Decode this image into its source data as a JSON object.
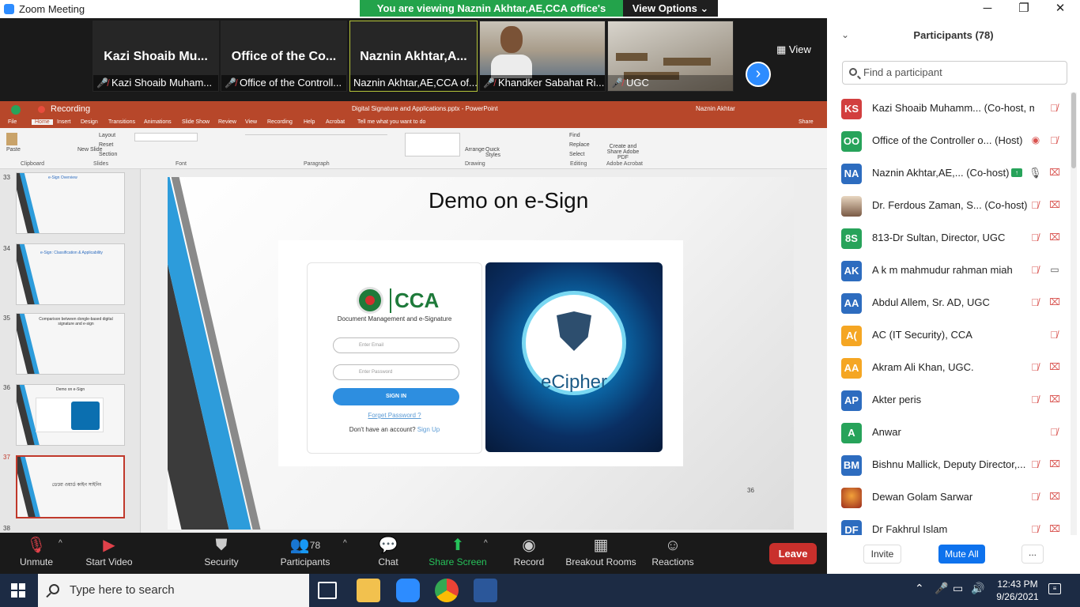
{
  "window": {
    "title": "Zoom Meeting",
    "minimize": "─",
    "restore": "❐",
    "close": "✕"
  },
  "banner": {
    "text": "You are viewing Naznin Akhtar,AE,CCA office's screen",
    "view_options": "View Options ⌄"
  },
  "strip": {
    "view_label": "View",
    "tiles": [
      {
        "big": "Kazi Shoaib Mu...",
        "name": "Kazi Shoaib Muham..."
      },
      {
        "big": "Office of the Co...",
        "name": "Office of the Controll..."
      },
      {
        "big": "Naznin Akhtar,A...",
        "name": "Naznin Akhtar,AE,CCA of..."
      },
      {
        "big": "",
        "name": "Khandker Sabahat Ri..."
      },
      {
        "big": "",
        "name": "UGC"
      }
    ],
    "next": "›"
  },
  "powerpoint": {
    "recording": "Recording",
    "doc_title": "Digital Signature and Applications.pptx - PowerPoint",
    "user": "Naznin Akhtar",
    "tabs": [
      "File",
      "Home",
      "Insert",
      "Design",
      "Transitions",
      "Animations",
      "Slide Show",
      "Review",
      "View",
      "Recording",
      "Help",
      "Acrobat",
      "Tell me what you want to do"
    ],
    "share": "Share",
    "ribbon_groups": [
      "Clipboard",
      "Slides",
      "Font",
      "Paragraph",
      "Drawing",
      "Editing",
      "Adobe Acrobat"
    ],
    "ribbon_items": [
      "Paste",
      "New Slide",
      "Layout",
      "Reset",
      "Section",
      "Find",
      "Replace",
      "Select",
      "Arrange",
      "Quick Styles",
      "Create and Share Adobe PDF"
    ],
    "thumb_numbers": [
      "33",
      "34",
      "35",
      "36",
      "37",
      "38"
    ],
    "thumb_titles": [
      "e-Sign Overview",
      "e-Sign: Classification & Applicability",
      "Comparison between dongle-based digital signature and e-sign",
      "Demo on e-Sign",
      "ডেমো ওয়ার্ড কাইন সাইনিং"
    ],
    "slide": {
      "title": "Demo on e-Sign",
      "cca": "CCA",
      "cca_sub": "Document Management and e-Signature",
      "email_ph": "Enter Email",
      "pass_ph": "Enter Password",
      "signin": "SIGN IN",
      "forgot": "Forget Password ?",
      "noacc": "Don't have an account?",
      "signup": "Sign Up",
      "ecipher": "eCipher",
      "page_number": "36"
    }
  },
  "participants": {
    "title": "Participants (78)",
    "search_placeholder": "Find a participant",
    "list": [
      {
        "initials": "KS",
        "color": "#d23f3f",
        "name": "Kazi Shoaib Muhamm... (Co-host, me)",
        "mic": "muted",
        "cam": "none"
      },
      {
        "initials": "OO",
        "color": "#27a35a",
        "name": "Office of the Controller o... (Host)",
        "mic": "muted",
        "cam": "rec"
      },
      {
        "initials": "NA",
        "color": "#2d6cbf",
        "name": "Naznin Akhtar,AE,... (Co-host)",
        "mic": "on",
        "cam": "off",
        "sharing": true
      },
      {
        "initials": "",
        "color": "img",
        "name": "Dr. Ferdous Zaman, S... (Co-host)",
        "mic": "muted",
        "cam": "off"
      },
      {
        "initials": "8S",
        "color": "#27a35a",
        "name": "813-Dr Sultan, Director, UGC",
        "mic": "muted",
        "cam": "off"
      },
      {
        "initials": "AK",
        "color": "#2d6cbf",
        "name": "A k m mahmudur rahman miah",
        "mic": "muted",
        "cam": "on"
      },
      {
        "initials": "AA",
        "color": "#2d6cbf",
        "name": "Abdul Allem, Sr. AD, UGC",
        "mic": "muted",
        "cam": "off"
      },
      {
        "initials": "A(",
        "color": "#f5a623",
        "name": "AC (IT Security), CCA",
        "mic": "muted",
        "cam": "none"
      },
      {
        "initials": "AA",
        "color": "#f5a623",
        "name": "Akram Ali Khan, UGC.",
        "mic": "muted",
        "cam": "off"
      },
      {
        "initials": "AP",
        "color": "#2d6cbf",
        "name": "Akter peris",
        "mic": "muted",
        "cam": "off"
      },
      {
        "initials": "A",
        "color": "#27a35a",
        "name": "Anwar",
        "mic": "muted",
        "cam": "none"
      },
      {
        "initials": "BM",
        "color": "#2d6cbf",
        "name": "Bishnu Mallick, Deputy Director,...",
        "mic": "muted",
        "cam": "off"
      },
      {
        "initials": "",
        "color": "img2",
        "name": "Dewan Golam Sarwar",
        "mic": "muted",
        "cam": "off"
      },
      {
        "initials": "DF",
        "color": "#2d6cbf",
        "name": "Dr Fakhrul Islam",
        "mic": "muted",
        "cam": "off"
      }
    ],
    "invite": "Invite",
    "mute_all": "Mute All",
    "more": "..."
  },
  "toolbar": {
    "unmute": "Unmute",
    "start_video": "Start Video",
    "security": "Security",
    "participants": "Participants",
    "participants_count": "78",
    "chat": "Chat",
    "share_screen": "Share Screen",
    "record": "Record",
    "breakout": "Breakout Rooms",
    "reactions": "Reactions",
    "leave": "Leave"
  },
  "taskbar": {
    "search_placeholder": "Type here to search",
    "time": "12:43 PM",
    "date": "9/26/2021"
  }
}
